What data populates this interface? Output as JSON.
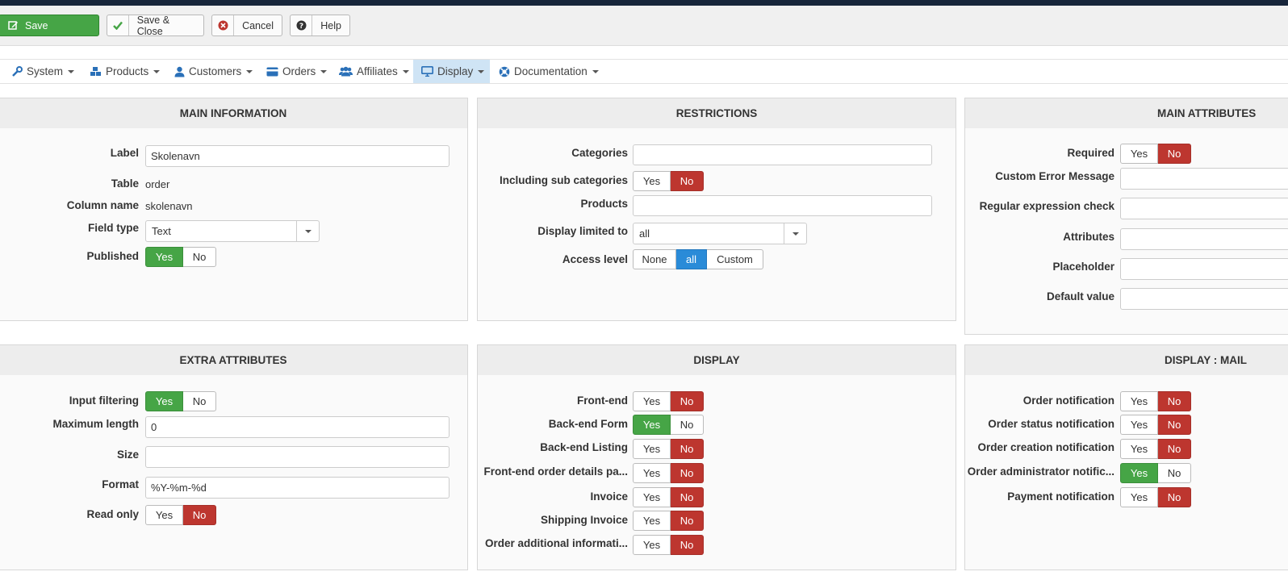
{
  "toolbar": {
    "save": "Save",
    "save_close": "Save & Close",
    "cancel": "Cancel",
    "help": "Help"
  },
  "nav": [
    "System",
    "Products",
    "Customers",
    "Orders",
    "Affiliates",
    "Display",
    "Documentation"
  ],
  "main_info": {
    "title": "MAIN INFORMATION",
    "label_label": "Label",
    "label_value": "Skolenavn",
    "table_label": "Table",
    "table_value": "order",
    "column_label": "Column name",
    "column_value": "skolenavn",
    "fieldtype_label": "Field type",
    "fieldtype_value": "Text",
    "published_label": "Published",
    "yes": "Yes",
    "no": "No"
  },
  "restrictions": {
    "title": "RESTRICTIONS",
    "categories_label": "Categories",
    "subcats_label": "Including sub categories",
    "products_label": "Products",
    "limited_label": "Display limited to",
    "limited_value": "all",
    "access_label": "Access level",
    "access_none": "None",
    "access_all": "all",
    "access_custom": "Custom",
    "yes": "Yes",
    "no": "No"
  },
  "main_attr": {
    "title": "MAIN ATTRIBUTES",
    "required_label": "Required",
    "error_label": "Custom Error Message",
    "regex_label": "Regular expression check",
    "attributes_label": "Attributes",
    "placeholder_label": "Placeholder",
    "default_label": "Default value",
    "yes": "Yes",
    "no": "No"
  },
  "extra_attr": {
    "title": "EXTRA ATTRIBUTES",
    "filter_label": "Input filtering",
    "maxlen_label": "Maximum length",
    "maxlen_value": "0",
    "size_label": "Size",
    "format_label": "Format",
    "format_value": "%Y-%m-%d",
    "readonly_label": "Read only",
    "yes": "Yes",
    "no": "No"
  },
  "display": {
    "title": "DISPLAY",
    "frontend": "Front-end",
    "backend_form": "Back-end Form",
    "backend_listing": "Back-end Listing",
    "frontend_order": "Front-end order details pa...",
    "invoice": "Invoice",
    "shipping": "Shipping Invoice",
    "order_info": "Order additional informati...",
    "yes": "Yes",
    "no": "No"
  },
  "display_mail": {
    "title": "DISPLAY : MAIL",
    "order_notif": "Order notification",
    "status_notif": "Order status notification",
    "creation_notif": "Order creation notification",
    "admin_notif": "Order administrator notific...",
    "payment_notif": "Payment notification",
    "yes": "Yes",
    "no": "No"
  },
  "colors": {
    "green": "#46a546",
    "red": "#bd362f",
    "blue": "#2a8bd8",
    "nav_active": "#cfe4f5"
  }
}
